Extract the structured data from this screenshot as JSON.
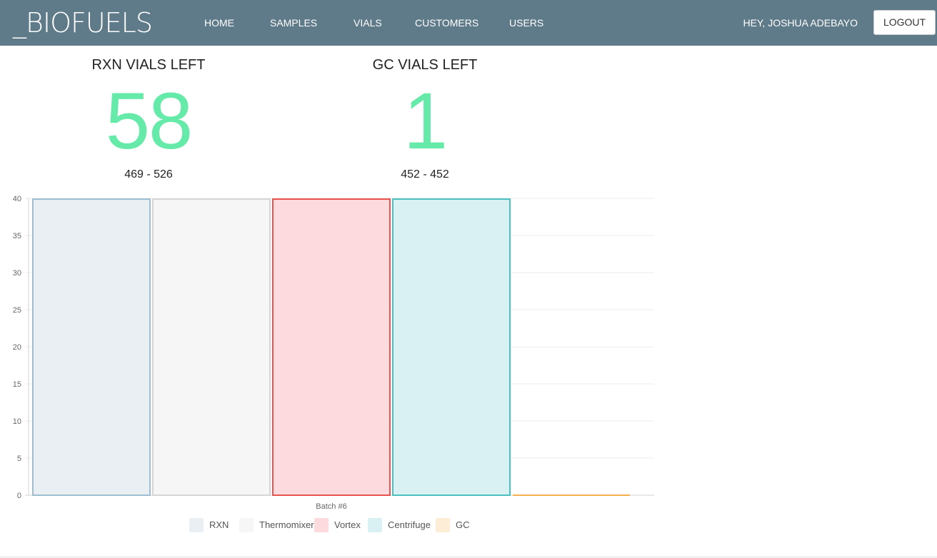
{
  "navbar": {
    "brand": "_BIOFUELS",
    "links": [
      "HOME",
      "SAMPLES",
      "VIALS",
      "CUSTOMERS",
      "USERS"
    ],
    "greeting": "HEY, JOSHUA ADEBAYO",
    "logout_label": "LOGOUT",
    "background_color": "#5f7a89"
  },
  "stats": {
    "rxn": {
      "title": "RXN VIALS LEFT",
      "value": "58",
      "range": "469 - 526"
    },
    "gc": {
      "title": "GC VIALS LEFT",
      "value": "1",
      "range": "452 - 452"
    },
    "value_color": "#66eaa9"
  },
  "chart_data": {
    "type": "bar",
    "categories": [
      "Batch #6"
    ],
    "series": [
      {
        "name": "RXN",
        "values": [
          40
        ],
        "fill": "#e9eff3",
        "stroke": "#9dbdd0"
      },
      {
        "name": "Thermomixer",
        "values": [
          40
        ],
        "fill": "#f6f6f6",
        "stroke": "#d6d6d6"
      },
      {
        "name": "Vortex",
        "values": [
          40
        ],
        "fill": "#fcdade",
        "stroke": "#e8524f"
      },
      {
        "name": "Centrifuge",
        "values": [
          40
        ],
        "fill": "#d9f1f2",
        "stroke": "#4bc1bf"
      },
      {
        "name": "GC",
        "values": [
          0
        ],
        "fill": "#fdecd6",
        "stroke": "#f4b04d"
      }
    ],
    "ylim": [
      0,
      40
    ],
    "yticks": [
      "0",
      "5",
      "10",
      "15",
      "20",
      "25",
      "30",
      "35",
      "40"
    ],
    "grid": true,
    "legend": "bottom"
  }
}
